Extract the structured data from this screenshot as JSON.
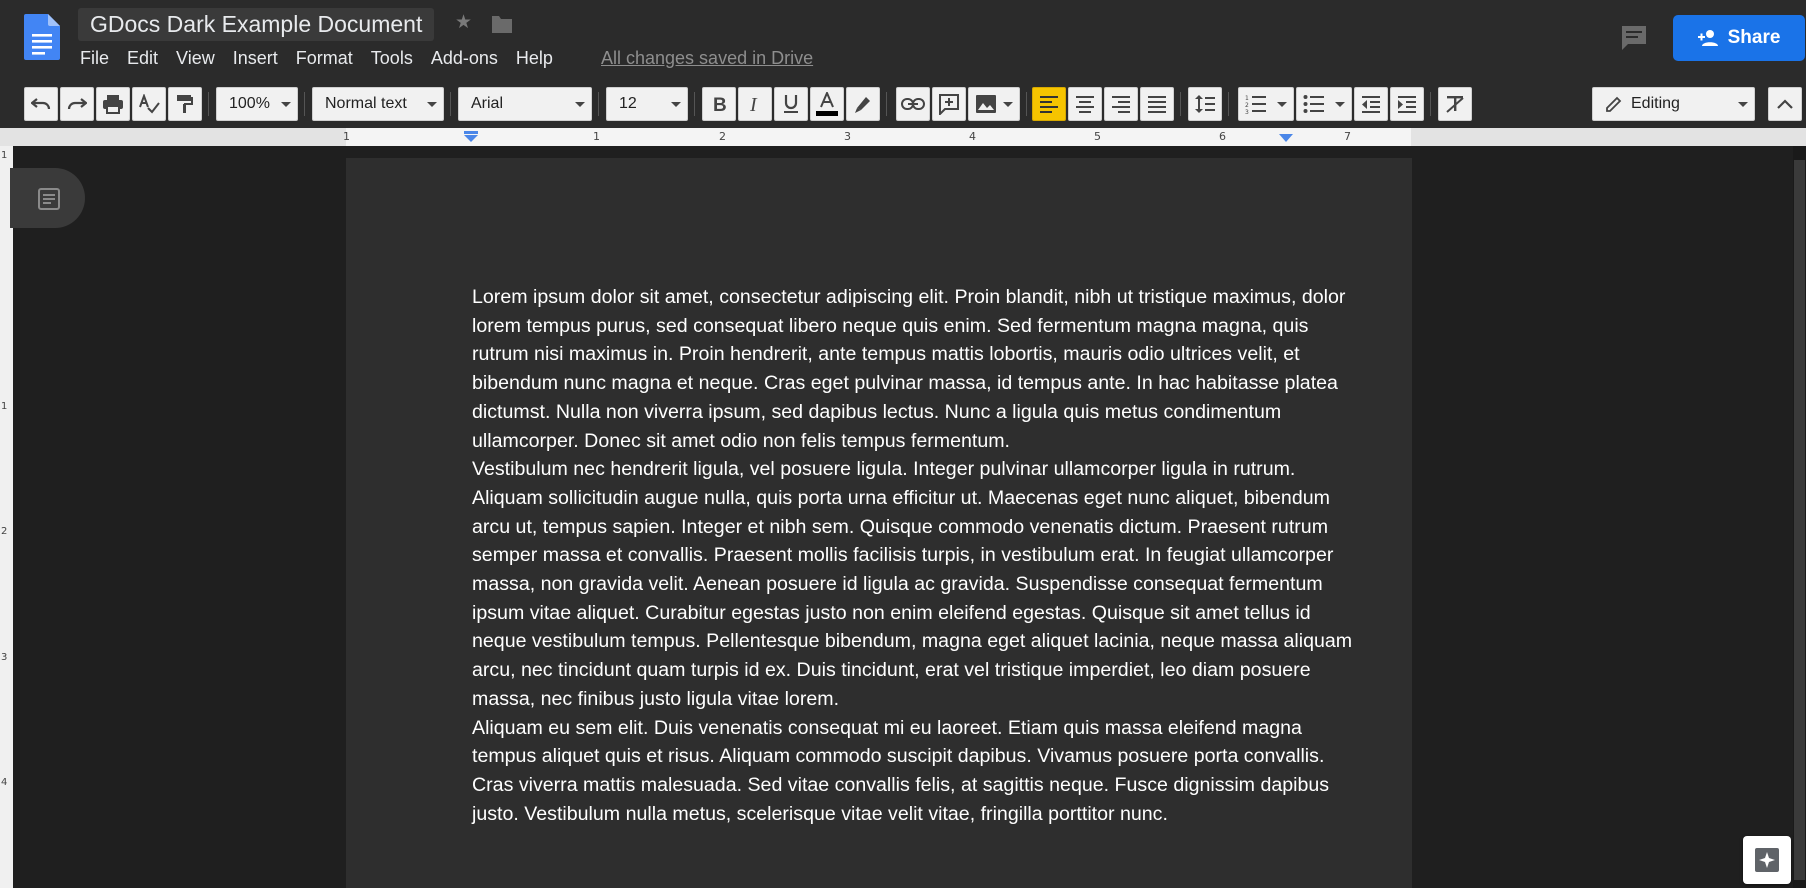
{
  "header": {
    "title": "GDocs Dark Example Document",
    "menu": [
      "File",
      "Edit",
      "View",
      "Insert",
      "Format",
      "Tools",
      "Add-ons",
      "Help"
    ],
    "save_status": "All changes saved in Drive",
    "share_label": "Share"
  },
  "toolbar": {
    "zoom": "100%",
    "style": "Normal text",
    "font": "Arial",
    "size": "12",
    "mode": "Editing"
  },
  "ruler": {
    "numbers": [
      "1",
      "1",
      "2",
      "3",
      "4",
      "5",
      "6",
      "7"
    ]
  },
  "vruler": {
    "numbers": [
      "1",
      "1",
      "2",
      "3",
      "4"
    ]
  },
  "document": {
    "paragraphs": [
      "Lorem ipsum dolor sit amet, consectetur adipiscing elit. Proin blandit, nibh ut tristique maximus, dolor lorem tempus purus, sed consequat libero neque quis enim. Sed fermentum magna magna, quis rutrum nisi maximus in. Proin hendrerit, ante tempus mattis lobortis, mauris odio ultrices velit, et bibendum nunc magna et neque. Cras eget pulvinar massa, id tempus ante. In hac habitasse platea dictumst. Nulla non viverra ipsum, sed dapibus lectus. Nunc a ligula quis metus condimentum ullamcorper. Donec sit amet odio non felis tempus fermentum.",
      "Vestibulum nec hendrerit ligula, vel posuere ligula. Integer pulvinar ullamcorper ligula in rutrum. Aliquam sollicitudin augue nulla, quis porta urna efficitur ut. Maecenas eget nunc aliquet, bibendum arcu ut, tempus sapien. Integer et nibh sem. Quisque commodo venenatis dictum. Praesent rutrum semper massa et convallis. Praesent mollis facilisis turpis, in vestibulum erat. In feugiat ullamcorper massa, non gravida velit. Aenean posuere id ligula ac gravida. Suspendisse consequat fermentum ipsum vitae aliquet. Curabitur egestas justo non enim eleifend egestas. Quisque sit amet tellus id neque vestibulum tempus. Pellentesque bibendum, magna eget aliquet lacinia, neque massa aliquam arcu, nec tincidunt quam turpis id ex. Duis tincidunt, erat vel tristique imperdiet, leo diam posuere massa, nec finibus justo ligula vitae lorem.",
      "Aliquam eu sem elit. Duis venenatis consequat mi eu laoreet. Etiam quis massa eleifend magna tempus aliquet quis et risus. Aliquam commodo suscipit dapibus. Vivamus posuere porta convallis. Cras viverra mattis malesuada. Sed vitae convallis felis, at sagittis neque. Fusce dignissim dapibus justo. Vestibulum nulla metus, scelerisque vitae velit vitae, fringilla porttitor nunc."
    ]
  },
  "colors": {
    "share_blue": "#1a73e8",
    "active_align": "#f6c400",
    "doc_logo_blue": "#4285f4"
  },
  "icons": {
    "doc_logo": "docs-logo-icon",
    "star": "star-icon",
    "folder": "folder-icon",
    "comment": "comment-icon",
    "share_person": "person-add-icon",
    "explore": "explore-icon"
  }
}
